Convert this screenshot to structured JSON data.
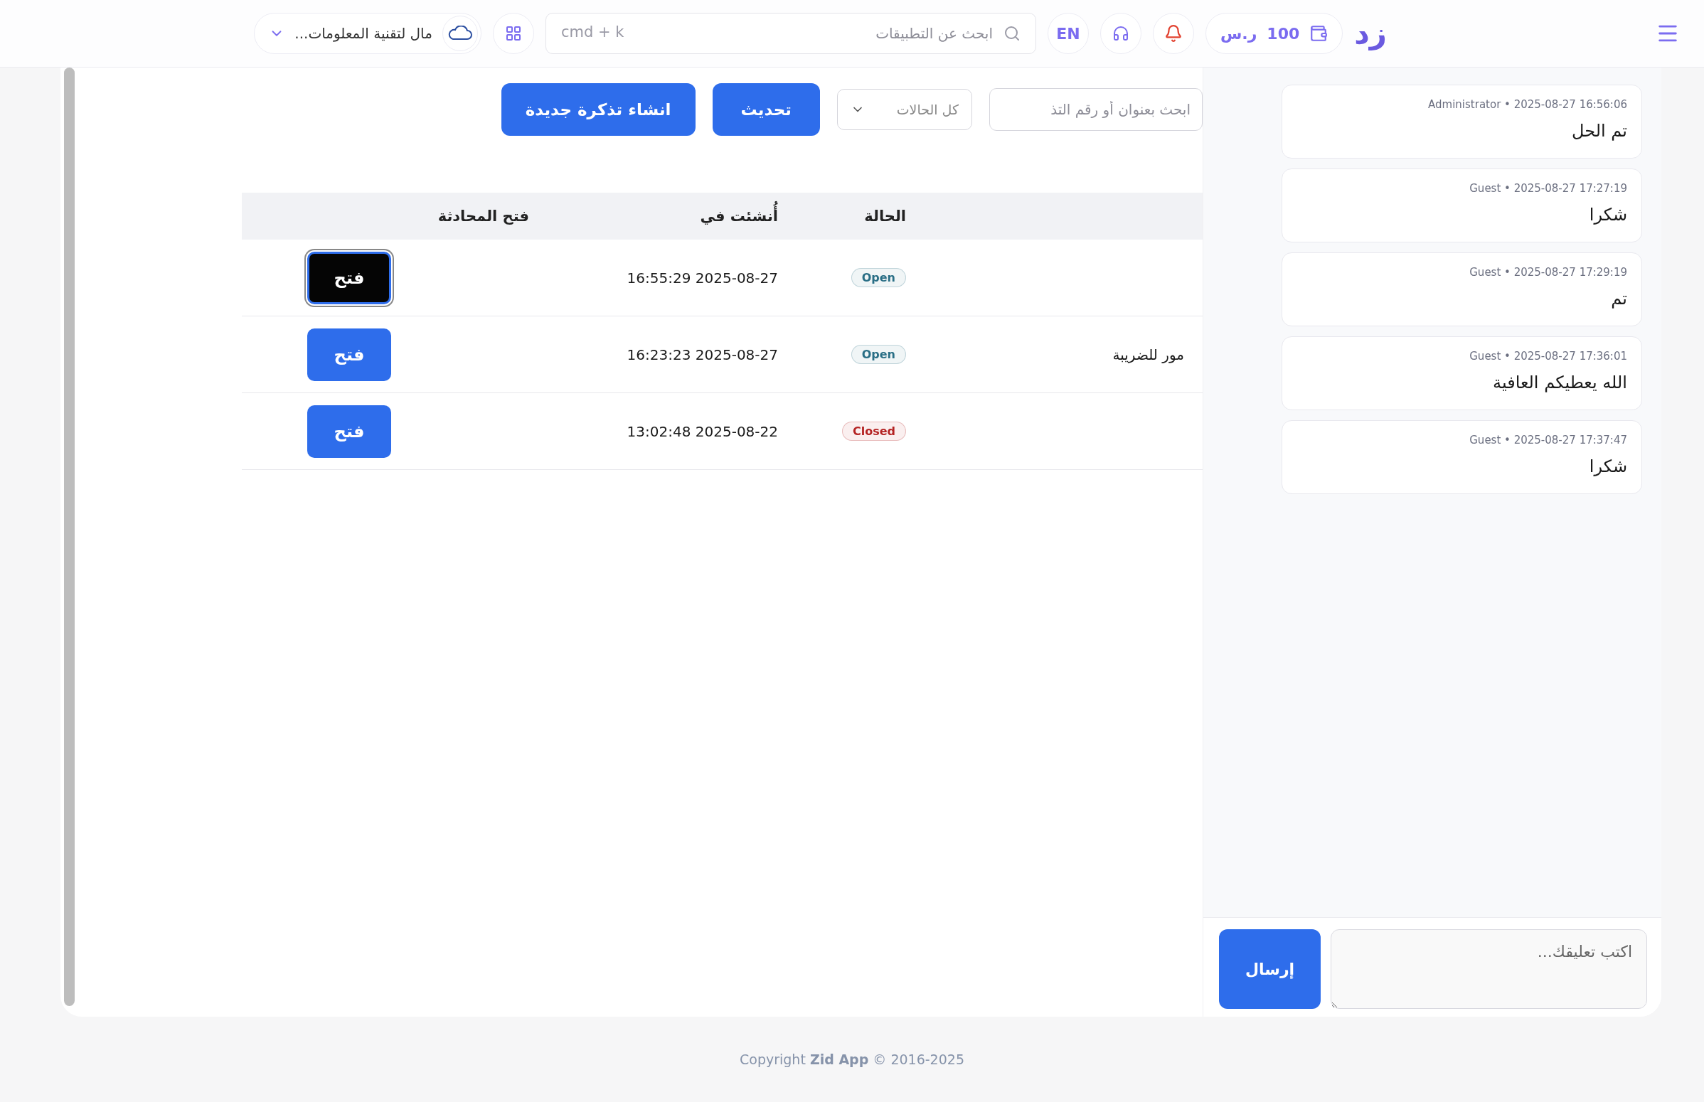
{
  "top_bar": {
    "logo": "زد",
    "wallet": {
      "amount": "100",
      "currency": "ر.س"
    },
    "language": "EN",
    "search": {
      "placeholder": "ابحث عن التطبيقات",
      "shortcut": "cmd + k"
    },
    "store": {
      "name": "مال لتقنية المعلومات..."
    }
  },
  "toolbar": {
    "search": {
      "placeholder": "ابحث بعنوان أو رقم التذ"
    },
    "status_filter": "كل الحالات",
    "buttons": [
      {
        "label": "تحديث",
        "kind": "refresh"
      },
      {
        "label": "انشاء تذكرة جديدة",
        "kind": "create"
      }
    ]
  },
  "table": {
    "columns": [
      "الحالة",
      "أُنشئت في",
      "فتح المحادثة"
    ],
    "rows": [
      {
        "status": "Open",
        "color": "#2a6f86",
        "created": "2025-08-27 16:55:29",
        "action": "فتح",
        "focused": true
      },
      {
        "column_1": "مور للضريبة",
        "status": "Open",
        "color": "#2a6f86",
        "created": "2025-08-27 16:23:23",
        "action": "فتح",
        "focused": false
      },
      {
        "status": "Closed",
        "color": "#b42323",
        "created": "2025-08-22 13:02:48",
        "action": "فتح",
        "focused": false
      }
    ]
  },
  "chat": {
    "messages": [
      {
        "meta": "Administrator • 2025-08-27 16:56:06",
        "text": "تم الحل"
      },
      {
        "meta": "Guest • 2025-08-27 17:27:19",
        "text": "شكرا"
      },
      {
        "meta": "Guest • 2025-08-27 17:29:19",
        "text": "تم"
      },
      {
        "meta": "Guest • 2025-08-27 17:36:01",
        "text": "الله يعطيكم العافية"
      },
      {
        "meta": "Guest • 2025-08-27 17:37:47",
        "text": "شكرا"
      }
    ],
    "input": {
      "placeholder": "اكتب تعليقك..."
    },
    "send_button": "إرسال"
  },
  "footer": "Copyright **Zid App** © 2016-2025"
}
